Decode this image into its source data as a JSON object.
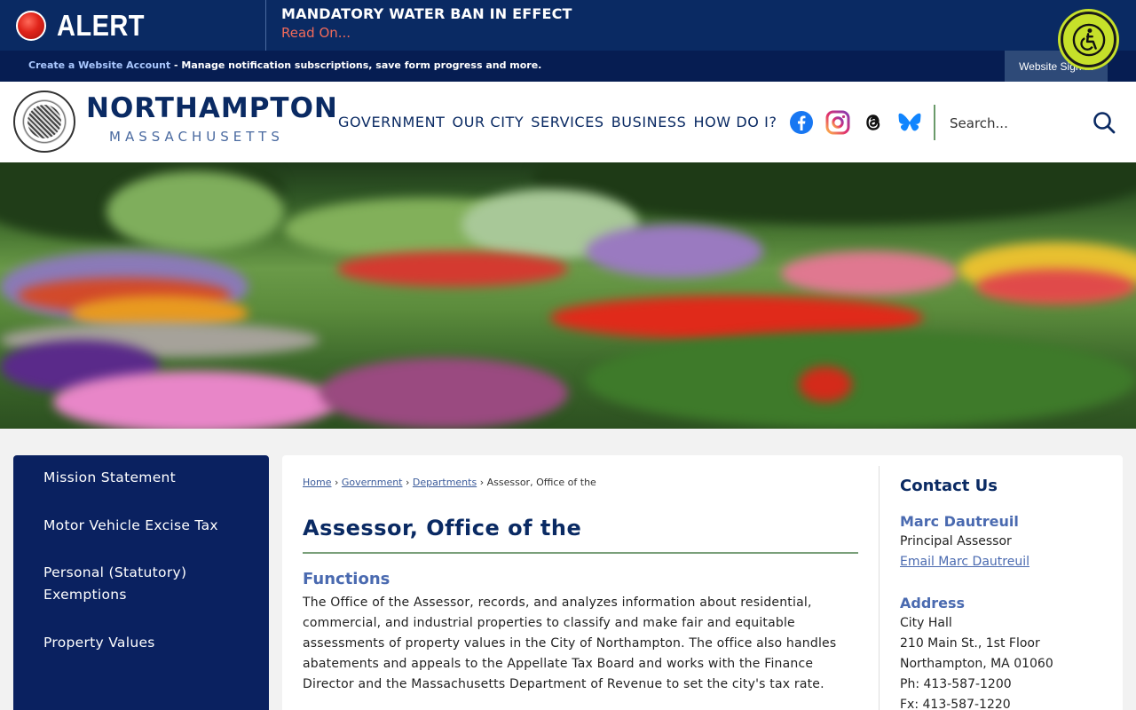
{
  "alert": {
    "label": "ALERT",
    "title": "MANDATORY WATER BAN IN EFFECT",
    "read_on": "Read On..."
  },
  "account": {
    "link": "Create a Website Account",
    "text": " - Manage notification subscriptions, save form progress and more.",
    "signin": "Website Sign In"
  },
  "brand": {
    "name": "NORTHAMPTON",
    "sub": "MASSACHUSETTS"
  },
  "nav": [
    "GOVERNMENT",
    "OUR CITY",
    "SERVICES",
    "BUSINESS",
    "HOW DO I?"
  ],
  "search": {
    "placeholder": "Search..."
  },
  "sidebar": {
    "items": [
      {
        "label": "Mission Statement"
      },
      {
        "label": "Motor Vehicle Excise Tax"
      },
      {
        "label": "Personal (Statutory) Exemptions"
      },
      {
        "label": "Property Values"
      }
    ]
  },
  "breadcrumb": {
    "home": "Home",
    "government": "Government",
    "departments": "Departments",
    "current": "Assessor, Office of the",
    "sep": "›"
  },
  "main": {
    "title": "Assessor, Office of the",
    "functions_heading": "Functions",
    "functions_body": "The Office of the Assessor, records, and analyzes information about residential, commercial, and industrial properties to classify and make fair and equitable assessments of property values in the City of Northampton. The office also handles abatements and appeals to the Appellate Tax Board and works with the Finance Director and the Massachusetts Department of Revenue to set the city's tax rate."
  },
  "contact": {
    "title": "Contact Us",
    "name": "Marc Dautreuil",
    "role": "Principal Assessor",
    "email": "Email Marc Dautreuil",
    "address_heading": "Address",
    "address_lines": [
      "City Hall",
      "210 Main St., 1st Floor",
      "Northampton, MA 01060",
      "Ph: 413-587-1200",
      "Fx: 413-587-1220"
    ]
  },
  "colors": {
    "navy": "#0a2a63",
    "accent_blue": "#4a6ab0",
    "alert_red": "#e0241a",
    "accessibility": "#c6e02a"
  }
}
